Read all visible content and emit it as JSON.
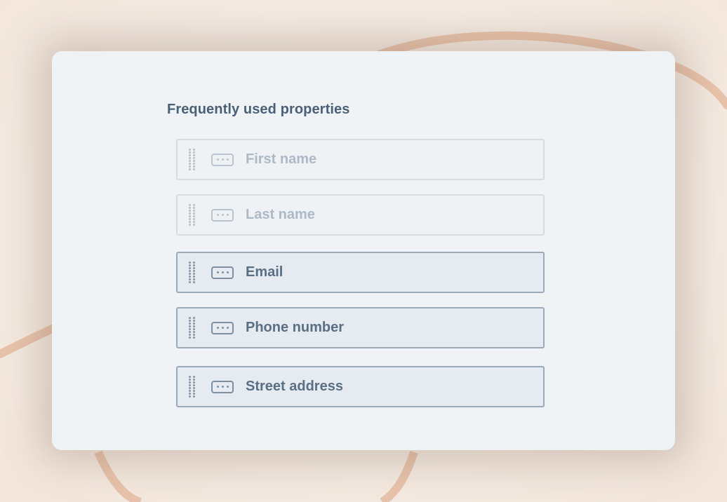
{
  "section": {
    "title": "Frequently used properties"
  },
  "properties": [
    {
      "label": "First name",
      "state": "faded"
    },
    {
      "label": "Last name",
      "state": "faded"
    },
    {
      "label": "Email",
      "state": "active"
    },
    {
      "label": "Phone number",
      "state": "active"
    },
    {
      "label": "Street address",
      "state": "active"
    }
  ],
  "icons": {
    "drag_handle": "drag-handle-icon",
    "field": "text-field-icon"
  },
  "colors": {
    "background": "#f5ebe2",
    "decorative_arc": "#e8bfa4",
    "panel": "#eff3f5",
    "title_text": "#4a6078",
    "active_border": "#9aaab9",
    "faded_border": "#d3dbe3"
  }
}
